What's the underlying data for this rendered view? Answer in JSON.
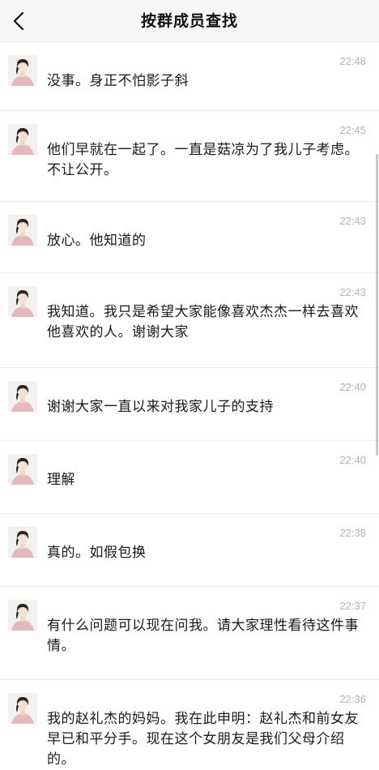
{
  "header": {
    "title": "按群成员查找",
    "back_icon": "chevron-left-icon"
  },
  "messages": [
    {
      "time": "22:48",
      "text": "没事。身正不怕影子斜"
    },
    {
      "time": "22:45",
      "text": "他们早就在一起了。一直是菇凉为了我儿子考虑。不让公开。"
    },
    {
      "time": "22:43",
      "text": "放心。他知道的"
    },
    {
      "time": "22:43",
      "text": "我知道。我只是希望大家能像喜欢杰杰一样去喜欢他喜欢的人。谢谢大家"
    },
    {
      "time": "22:40",
      "text": "谢谢大家一直以来对我家儿子的支持"
    },
    {
      "time": "22:40",
      "text": "理解"
    },
    {
      "time": "22:38",
      "text": "真的。如假包换"
    },
    {
      "time": "22:37",
      "text": "有什么问题可以现在问我。请大家理性看待这件事情。"
    },
    {
      "time": "22:36",
      "text": "我的赵礼杰的妈妈。我在此申明：赵礼杰和前女友早已和平分手。现在这个女朋友是我们父母介绍的。"
    }
  ],
  "colors": {
    "nav_background": "#f6f6f6",
    "time_text": "#b4b4b4",
    "message_text": "#1a1a1a",
    "divider": "#ececec",
    "avatar_garment": "#e5b8bd"
  }
}
